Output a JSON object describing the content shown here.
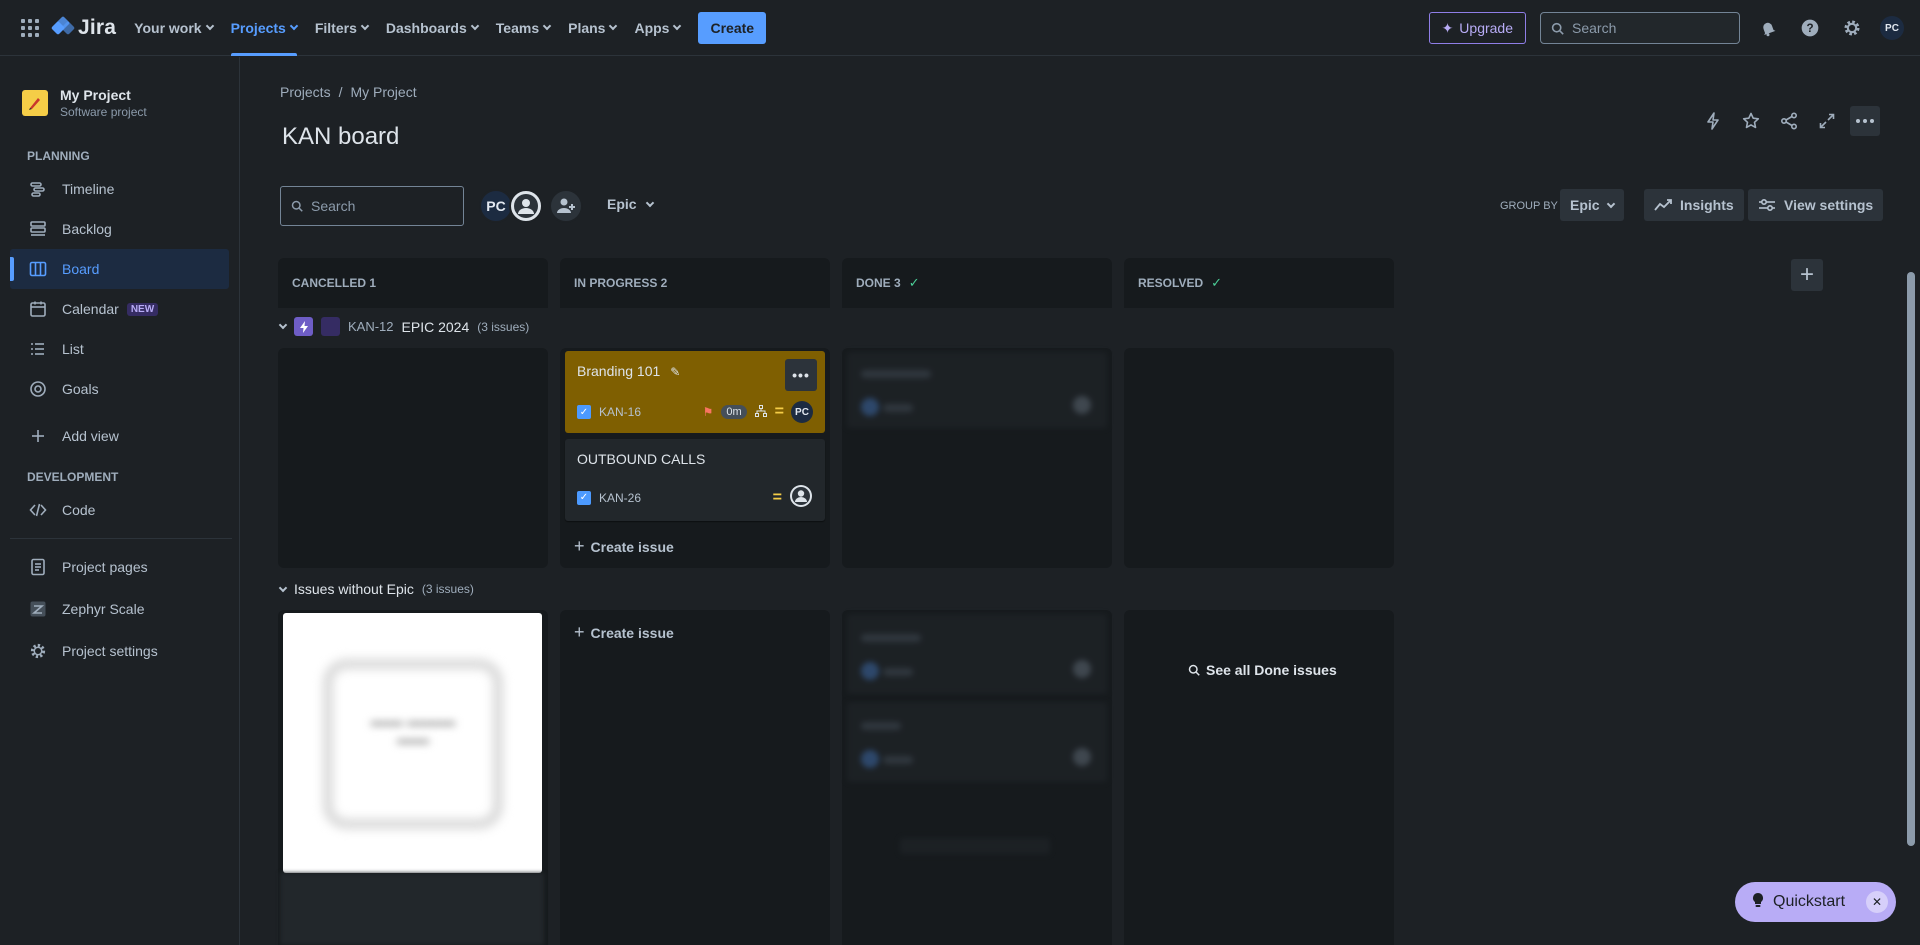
{
  "topnav": {
    "logo_text": "Jira",
    "items": [
      {
        "label": "Your work"
      },
      {
        "label": "Projects"
      },
      {
        "label": "Filters"
      },
      {
        "label": "Dashboards"
      },
      {
        "label": "Teams"
      },
      {
        "label": "Plans"
      },
      {
        "label": "Apps"
      }
    ],
    "create_label": "Create",
    "upgrade_label": "Upgrade",
    "search_placeholder": "Search",
    "user_initials": "PC"
  },
  "sidebar": {
    "project_name": "My Project",
    "project_type": "Software project",
    "planning_label": "PLANNING",
    "development_label": "DEVELOPMENT",
    "items": [
      {
        "label": "Timeline",
        "icon": "timeline-icon"
      },
      {
        "label": "Backlog",
        "icon": "backlog-icon"
      },
      {
        "label": "Board",
        "icon": "board-icon"
      },
      {
        "label": "Calendar",
        "icon": "calendar-icon",
        "badge": "NEW"
      },
      {
        "label": "List",
        "icon": "list-icon"
      },
      {
        "label": "Goals",
        "icon": "goals-icon"
      },
      {
        "label": "Add view",
        "icon": "plus-icon"
      }
    ],
    "dev_items": [
      {
        "label": "Code",
        "icon": "code-icon"
      }
    ],
    "bottom_items": [
      {
        "label": "Project pages",
        "icon": "pages-icon"
      },
      {
        "label": "Zephyr Scale",
        "icon": "zephyr-icon"
      },
      {
        "label": "Project settings",
        "icon": "gear-icon"
      }
    ]
  },
  "breadcrumb": [
    "Projects",
    "/",
    "My Project"
  ],
  "page_title": "KAN board",
  "toolbar": {
    "search_placeholder": "Search",
    "avatar_initials": "PC",
    "epic_filter": "Epic",
    "group_by_label": "GROUP BY",
    "group_by_value": "Epic",
    "insights_label": "Insights",
    "view_settings_label": "View settings"
  },
  "columns": [
    {
      "label": "CANCELLED 1",
      "done": false
    },
    {
      "label": "IN PROGRESS 2",
      "done": false
    },
    {
      "label": "DONE 3",
      "done": true
    },
    {
      "label": "RESOLVED",
      "done": true
    }
  ],
  "swimlanes": [
    {
      "key": "KAN-12",
      "name": "EPIC 2024",
      "count": "(3 issues)"
    },
    {
      "name": "Issues without Epic",
      "count": "(3 issues)"
    }
  ],
  "cards": [
    {
      "title": "Branding 101",
      "key": "KAN-16",
      "estimate": "0m",
      "assignee": "PC"
    },
    {
      "title": "OUTBOUND CALLS",
      "key": "KAN-26"
    }
  ],
  "create_issue_label": "Create issue",
  "see_all_done_label": "See all Done issues",
  "quickstart_label": "Quickstart",
  "colors": {
    "accent": "#579dff",
    "card_highlight": "#7f5f01",
    "done_check": "#4bce97",
    "quickstart": "#b8acf6"
  }
}
